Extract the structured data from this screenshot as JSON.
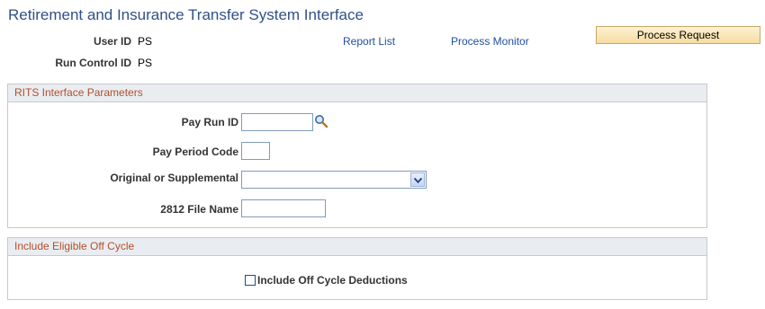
{
  "page": {
    "title": "Retirement and Insurance Transfer System Interface"
  },
  "header": {
    "user_id_label": "User ID",
    "user_id_value": "PS",
    "run_control_label": "Run Control ID",
    "run_control_value": "PS",
    "report_list_link": "Report List",
    "process_monitor_link": "Process Monitor",
    "process_request_button": "Process Request"
  },
  "rits_group": {
    "title": "RITS Interface Parameters",
    "pay_run_id_label": "Pay Run ID",
    "pay_run_id_value": "",
    "pay_period_code_label": "Pay Period Code",
    "pay_period_code_value": "",
    "orig_supp_label": "Original or Supplemental",
    "orig_supp_value": "",
    "file_name_label": "2812 File Name",
    "file_name_value": ""
  },
  "offcycle_group": {
    "title": "Include Eligible Off Cycle",
    "checkbox_label": "Include Off Cycle Deductions",
    "checked": false
  },
  "icons": {
    "lookup": "magnifier-icon",
    "dropdown": "chevron-down-icon"
  },
  "colors": {
    "title": "#30508a",
    "group_header_text": "#b24f2b",
    "link": "#1f4fa0",
    "button_bg": "#f6dca0"
  }
}
